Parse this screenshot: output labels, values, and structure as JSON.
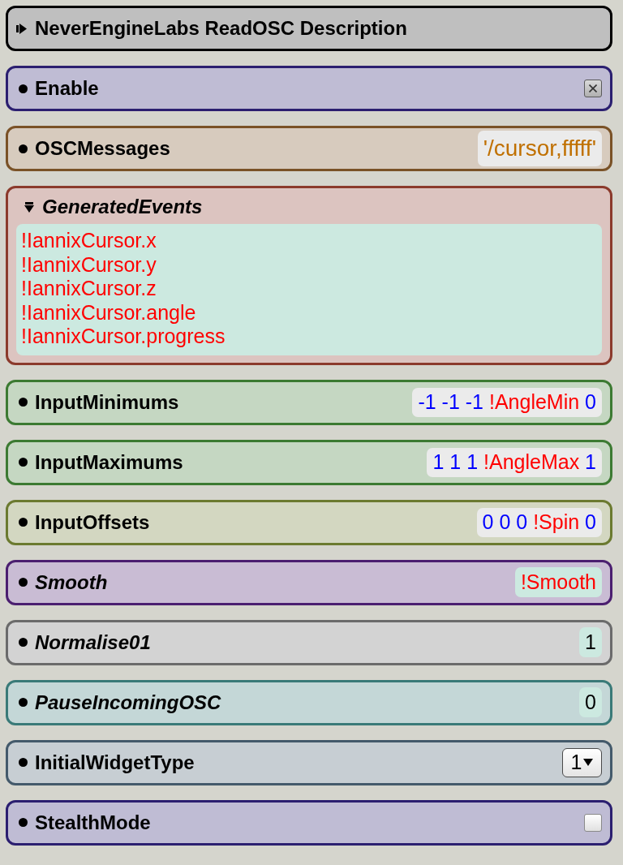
{
  "header": {
    "title": "NeverEngineLabs ReadOSC Description",
    "expanded": false
  },
  "parameters": [
    {
      "kind": "checkbox",
      "label": "Enable",
      "italic": false,
      "color": "#2b1f70",
      "checked": true
    },
    {
      "kind": "string",
      "label": "OSCMessages",
      "italic": false,
      "color": "#7a5227",
      "tokens": [
        {
          "text": "'/cursor,fffff'",
          "color": "#c07000"
        }
      ]
    },
    {
      "kind": "event_list",
      "label": "GeneratedEvents",
      "italic": true,
      "color": "#8b3a2c",
      "expanded": true,
      "events": [
        "!IannixCursor.x",
        "!IannixCursor.y",
        "!IannixCursor.z",
        "!IannixCursor.angle",
        "!IannixCursor.progress"
      ]
    },
    {
      "kind": "vector",
      "label": "InputMinimums",
      "italic": false,
      "color": "#3c7a32",
      "tokens": [
        {
          "text": "-1",
          "color": "#0000ff"
        },
        {
          "text": "-1",
          "color": "#0000ff"
        },
        {
          "text": "-1",
          "color": "#0000ff"
        },
        {
          "text": "!AngleMin",
          "color": "#ff0000"
        },
        {
          "text": "0",
          "color": "#0000ff"
        }
      ]
    },
    {
      "kind": "vector",
      "label": "InputMaximums",
      "italic": false,
      "color": "#3c7a32",
      "tokens": [
        {
          "text": "1",
          "color": "#0000ff"
        },
        {
          "text": "1",
          "color": "#0000ff"
        },
        {
          "text": "1",
          "color": "#0000ff"
        },
        {
          "text": "!AngleMax",
          "color": "#ff0000"
        },
        {
          "text": "1",
          "color": "#0000ff"
        }
      ]
    },
    {
      "kind": "vector",
      "label": "InputOffsets",
      "italic": false,
      "color": "#6b7a30",
      "tokens": [
        {
          "text": "0",
          "color": "#0000ff"
        },
        {
          "text": "0",
          "color": "#0000ff"
        },
        {
          "text": "0",
          "color": "#0000ff"
        },
        {
          "text": "!Spin",
          "color": "#ff0000"
        },
        {
          "text": "0",
          "color": "#0000ff"
        }
      ]
    },
    {
      "kind": "scalar",
      "label": "Smooth",
      "italic": true,
      "color": "#4b1f70",
      "tokens": [
        {
          "text": "!Smooth",
          "color": "#ff0000"
        }
      ]
    },
    {
      "kind": "scalar",
      "label": "Normalise01",
      "italic": true,
      "color": "#6b6b6b",
      "tokens": [
        {
          "text": "1",
          "color": "#000000"
        }
      ]
    },
    {
      "kind": "scalar",
      "label": "PauseIncomingOSC",
      "italic": true,
      "color": "#3a7a78",
      "tokens": [
        {
          "text": "0",
          "color": "#000000"
        }
      ]
    },
    {
      "kind": "dropdown",
      "label": "InitialWidgetType",
      "italic": false,
      "color": "#445a6b",
      "value": "1"
    },
    {
      "kind": "checkbox",
      "label": "StealthMode",
      "italic": false,
      "color": "#2b1f70",
      "checked": false
    }
  ]
}
